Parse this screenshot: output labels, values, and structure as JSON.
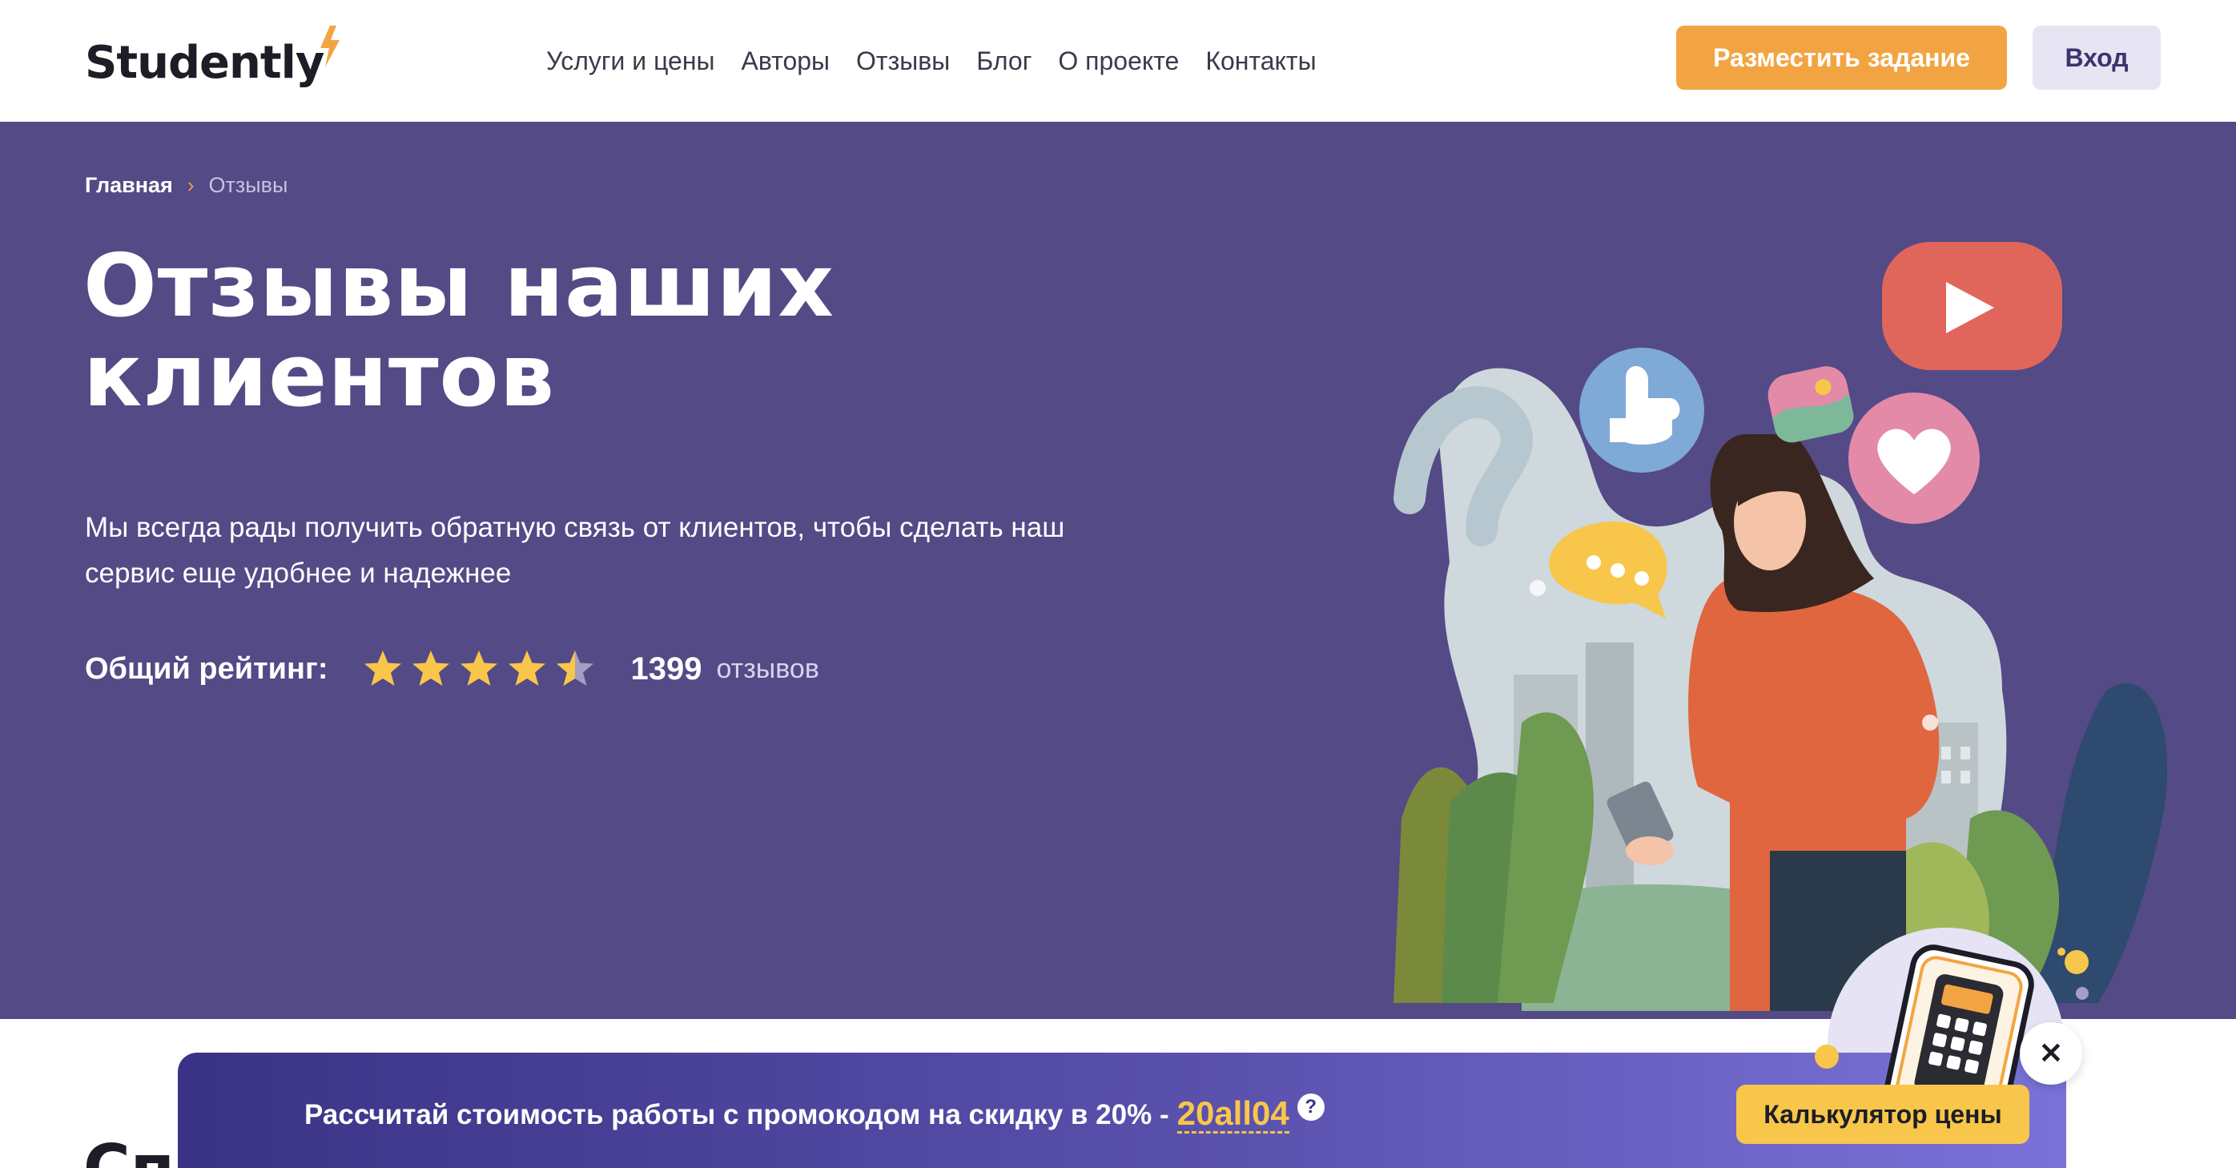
{
  "header": {
    "logo": "Studently",
    "nav": [
      "Услуги и цены",
      "Авторы",
      "Отзывы",
      "Блог",
      "О проекте",
      "Контакты"
    ],
    "post_button": "Разместить задание",
    "login_button": "Вход"
  },
  "hero": {
    "breadcrumb": {
      "home": "Главная",
      "separator": "›",
      "current": "Отзывы"
    },
    "title_line1": "Отзывы наших",
    "title_line2": "клиентов",
    "subtitle_line1": "Мы всегда рады получить обратную связь от клиентов, чтобы сделать наш",
    "subtitle_line2": "сервис еще удобнее и надежнее",
    "rating": {
      "label": "Общий рейтинг:",
      "stars": 4.5,
      "max_stars": 5,
      "count": "1399",
      "count_word": "отзывов"
    }
  },
  "section": {
    "title_partial": "Сп"
  },
  "promo": {
    "text": "Рассчитай стоимость работы с промокодом на скидку в 20% -",
    "code": "20all04",
    "help_icon": "?",
    "calc_button": "Калькулятор цены",
    "close_icon": "✕"
  },
  "colors": {
    "accent_orange": "#f3a442",
    "hero_bg": "#544a86",
    "promo_yellow": "#f7c64a",
    "login_bg": "#e7e4f3"
  }
}
